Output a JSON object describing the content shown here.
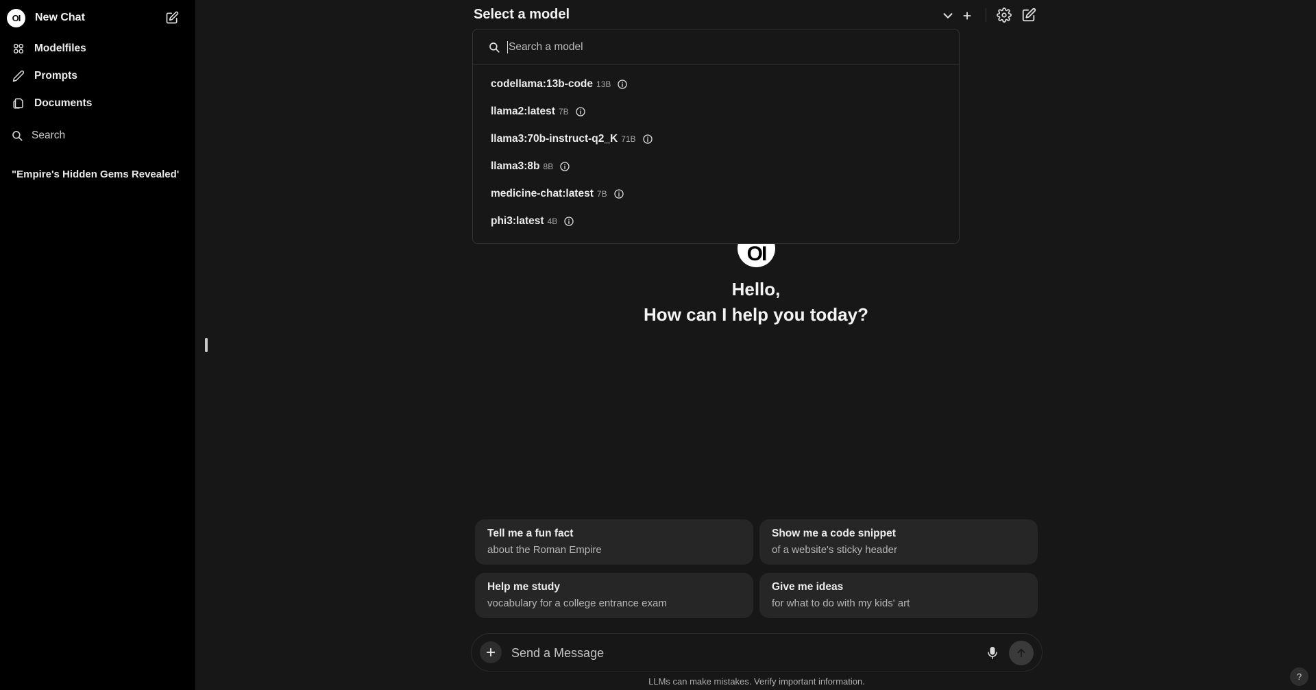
{
  "sidebar": {
    "new_chat": {
      "logo_text": "OI",
      "label": "New Chat",
      "edit_icon": "pencil-square-icon"
    },
    "items": [
      {
        "label": "Modelfiles",
        "icon": "grid-icon"
      },
      {
        "label": "Prompts",
        "icon": "pencil-icon"
      },
      {
        "label": "Documents",
        "icon": "documents-icon"
      }
    ],
    "search_label": "Search",
    "chats": [
      "\"Empire's Hidden Gems Revealed'"
    ]
  },
  "header": {
    "title": "Select a model",
    "icons": [
      "chevron-down-icon",
      "plus-icon",
      "gear-icon",
      "new-chat-icon"
    ]
  },
  "model_dropdown": {
    "search_placeholder": "Search a model",
    "models": [
      {
        "name": "codellama:13b-code",
        "size": "13B"
      },
      {
        "name": "llama2:latest",
        "size": "7B"
      },
      {
        "name": "llama3:70b-instruct-q2_K",
        "size": "71B"
      },
      {
        "name": "llama3:8b",
        "size": "8B"
      },
      {
        "name": "medicine-chat:latest",
        "size": "7B"
      },
      {
        "name": "phi3:latest",
        "size": "4B"
      }
    ]
  },
  "greeting": {
    "logo_text": "OI",
    "line1": "Hello,",
    "line2": "How can I help you today?"
  },
  "suggestions": [
    {
      "title": "Tell me a fun fact",
      "subtitle": "about the Roman Empire"
    },
    {
      "title": "Show me a code snippet",
      "subtitle": "of a website's sticky header"
    },
    {
      "title": "Help me study",
      "subtitle": "vocabulary for a college entrance exam"
    },
    {
      "title": "Give me ideas",
      "subtitle": "for what to do with my kids' art"
    }
  ],
  "input": {
    "placeholder": "Send a Message"
  },
  "footer": {
    "disclaimer": "LLMs can make mistakes. Verify important information.",
    "help": "?"
  }
}
